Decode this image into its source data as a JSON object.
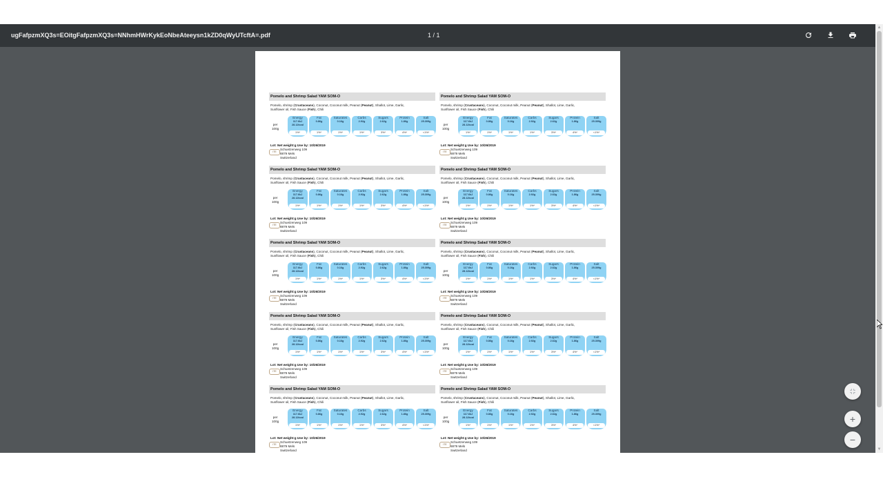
{
  "toolbar": {
    "filename": "ugFafpzmXQ3s=EOitgFafpzmXQ3s=NNhmHWrKykEoNbeAteeysn1kZD0qWyUTcftA=.pdf",
    "page_indicator": "1 / 1",
    "rotate_icon": "rotate-icon",
    "download_icon": "download-icon",
    "print_icon": "print-icon"
  },
  "label": {
    "title": "Pomelo and Shrimp Salad YAM SOM-O",
    "ingredients_line1_prefix": "Pomelo, shrimp (",
    "ingredients_allergen1": "Crustaceans",
    "ingredients_line1_mid": "), Coconut, Coconut milk, Peanut (",
    "ingredients_allergen2": "Peanut",
    "ingredients_line1_suffix": "), Shallot, Lime, Garlic,",
    "ingredients_line2_prefix": "Sunflower oil, Fish Sauce (",
    "ingredients_allergen3": "Fish",
    "ingredients_line2_suffix": "), Chili",
    "per_line1": "per",
    "per_line2": "100g",
    "nutrition": [
      {
        "name": "Energy",
        "value": "117.6kJ 28.12kcal",
        "percent": "1%*"
      },
      {
        "name": "Fat",
        "value": "0.86g",
        "percent": "1%*"
      },
      {
        "name": "Saturates",
        "value": "0.16g",
        "percent": "1%*"
      },
      {
        "name": "Carbs",
        "value": "2.92g",
        "percent": "1%*"
      },
      {
        "name": "Sugars",
        "value": "2.62g",
        "percent": "3%*"
      },
      {
        "name": "Protein",
        "value": "1.86g",
        "percent": "4%*"
      },
      {
        "name": "Salt",
        "value": "25.309g",
        "percent": "<1%*"
      }
    ],
    "lot_line": "Lot:    Net weight:g Use by: 10/26/2019",
    "logo_text": "ITE",
    "address_line1": "Schuetzenweg 109",
    "address_line2": "8879 Mels",
    "address_line3": "Switzerland"
  },
  "controls": {
    "fit_icon": "fit-to-page-icon",
    "zoom_in_icon": "zoom-in-icon",
    "zoom_out_icon": "zoom-out-icon",
    "zoom_in_glyph": "+",
    "zoom_out_glyph": "−"
  }
}
